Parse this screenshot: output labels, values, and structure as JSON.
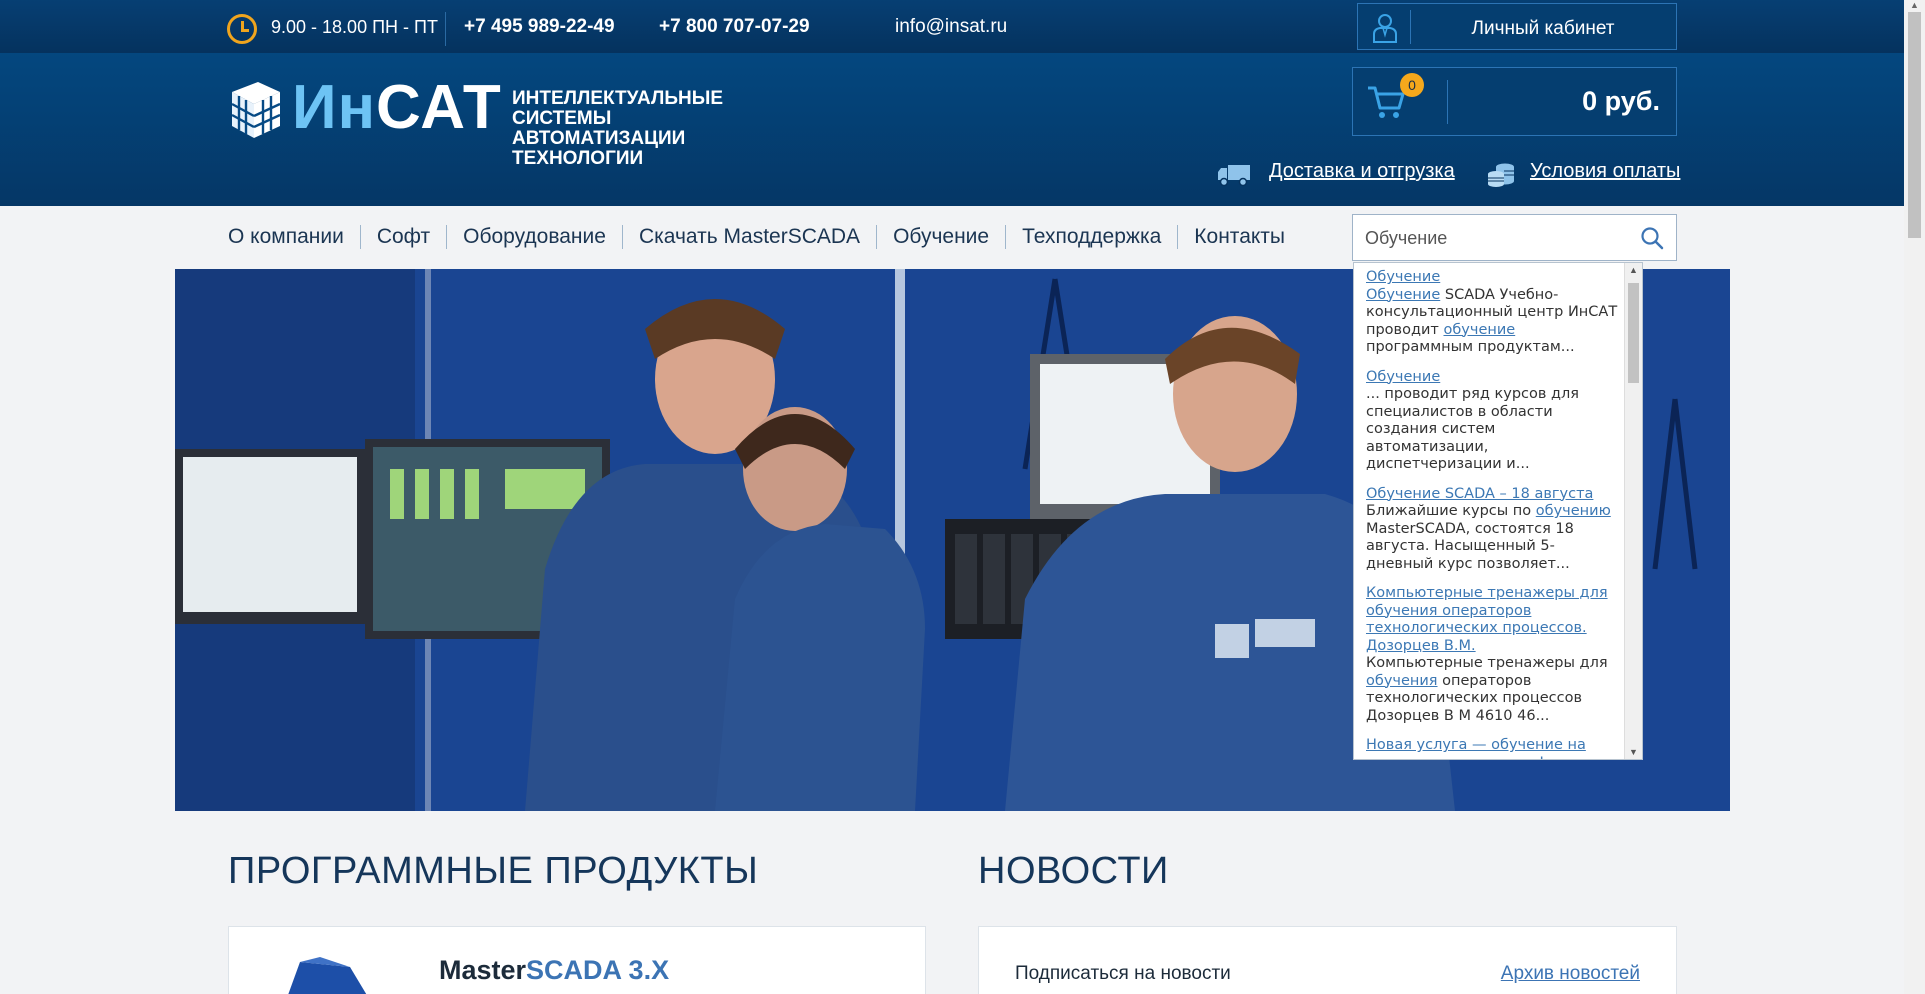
{
  "topbar": {
    "hours": "9.00 - 18.00 ПН - ПТ",
    "phone1": "+7 495 989-22-49",
    "phone2": "+7 800 707-07-29",
    "email": "info@insat.ru",
    "cabinet_label": "Личный кабинет"
  },
  "header": {
    "logo_part1": "Ин",
    "logo_part2": "САТ",
    "tagline": [
      "ИНТЕЛЛЕКТУАЛЬНЫЕ",
      "СИСТЕМЫ",
      "АВТОМАТИЗАЦИИ",
      "ТЕХНОЛОГИИ"
    ],
    "cart_count": "0",
    "cart_sum": "0 руб.",
    "delivery_link": "Доставка и отгрузка",
    "payment_link": "Условия оплаты"
  },
  "nav": {
    "items": [
      "О компании",
      "Софт",
      "Оборудование",
      "Скачать MasterSCADA",
      "Обучение",
      "Техподдержка",
      "Контакты"
    ]
  },
  "search": {
    "value": "Обучение"
  },
  "search_results": [
    {
      "title": "Обучение",
      "snippet_link": "Обучение",
      "snippet": " SCADA Учебно-консультационный центр ИнСАТ проводит ",
      "snippet_link2": "обучение",
      "snippet_end": " программным продуктам..."
    },
    {
      "title": "Обучение",
      "snippet": "... проводит ряд курсов для специалистов в области создания систем автоматизации, диспетчеризации и..."
    },
    {
      "title": "Обучение SCADA – 18 августа",
      "snippet": "Ближайшие курсы по ",
      "snippet_link2": "обучению",
      "snippet_end": " MasterSCADA, состоятся 18 августа. Насыщенный 5-дневный курс позволяет..."
    },
    {
      "title": "Компьютерные тренажеры для обучения операторов технологических процессов. Дозорцев В.М.",
      "snippet": "Компьютерные тренажеры для ",
      "snippet_link2": "обучения",
      "snippet_end": " операторов технологических процессов Дозорцев В М 4610 46..."
    },
    {
      "title": "Новая услуга — обучение на территории заказчика!",
      "snippet": ""
    }
  ],
  "products": {
    "title": "ПРОГРАММНЫЕ ПРОДУКТЫ",
    "card_title_a": "Master",
    "card_title_b": "SCADA 3.X"
  },
  "news": {
    "title": "НОВОСТИ",
    "subscribe": "Подписаться на новости",
    "archive": "Архив новостей"
  },
  "colors": {
    "topbar": "#05325e",
    "header": "#04477f",
    "accent_orange": "#f5a81c",
    "logo_blue": "#6dc3f4",
    "link_blue": "#3c74b4"
  }
}
